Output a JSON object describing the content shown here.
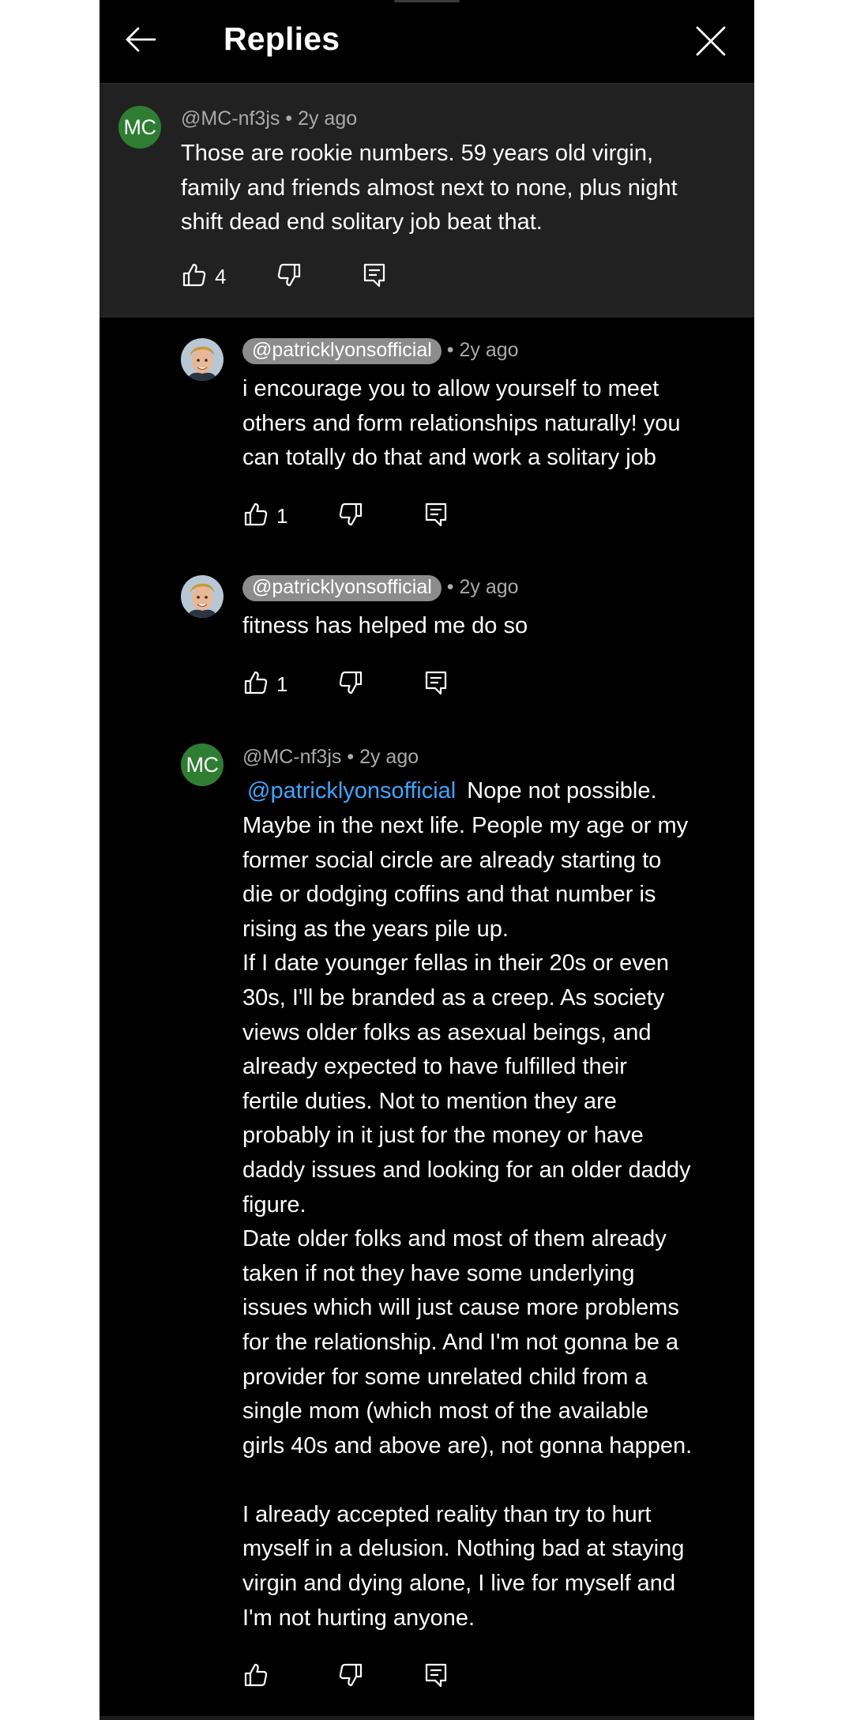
{
  "header": {
    "title": "Replies"
  },
  "parent_comment": {
    "avatar_initials": "MC",
    "author": "@MC-nf3js",
    "separator": "•",
    "time": "2y ago",
    "text": "Those are rookie numbers. 59 years old virgin,\nfamily and friends almost next to none, plus night\nshift dead end solitary job beat that.",
    "likes": "4"
  },
  "replies": [
    {
      "author": "@patricklyonsofficial",
      "separator": "•",
      "time": "2y ago",
      "text": "i encourage you to allow yourself to meet\nothers and form relationships naturally! you\ncan totally do that and work a solitary job",
      "likes": "1"
    },
    {
      "author": "@patricklyonsofficial",
      "separator": "•",
      "time": "2y ago",
      "text": "fitness has helped me do so",
      "likes": "1"
    },
    {
      "avatar_initials": "MC",
      "author": "@MC-nf3js",
      "separator": "•",
      "time": "2y ago",
      "mention": "@patricklyonsofficial",
      "first_line_rest": "Nope not possible.",
      "text": "Maybe in the next life. People my age or my\nformer social circle are already starting to\ndie or dodging coffins and that number is\nrising as the years pile up.\nIf I date younger fellas in their 20s or even\n30s, I'll be branded as a creep. As society\nviews older folks as asexual beings, and\nalready expected to have fulfilled their\nfertile duties. Not to mention they are\nprobably in it just for the money or have\ndaddy issues and looking for an older daddy\nfigure.\n Date older folks and most of them already\ntaken if not they have some underlying\nissues which will just cause more problems\nfor the relationship. And I'm not gonna be a\nprovider for some unrelated child from a\nsingle mom (which most of the available\ngirls 40s and above are), not gonna happen.\n\nI already accepted reality than try to hurt\nmyself in a delusion. Nothing bad at staying\nvirgin and dying alone, I live for myself and\nI'm not hurting anyone."
    }
  ],
  "icons": {
    "back": "arrow-left-icon",
    "close": "close-icon",
    "like": "thumbs-up-icon",
    "dislike": "thumbs-down-icon",
    "reply": "reply-comment-icon"
  },
  "colors": {
    "background": "#000000",
    "parent_background": "#212121",
    "avatar_green": "#2e7d32",
    "mention_blue": "#3ea6ff",
    "meta_gray": "#aaaaaa",
    "chip_gray": "#8c8c8c"
  }
}
